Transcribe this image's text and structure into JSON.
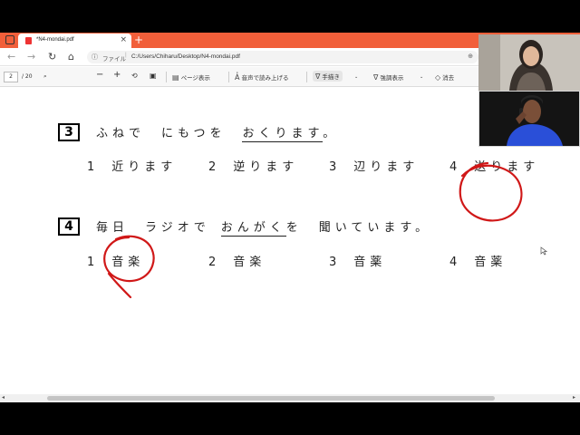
{
  "browser": {
    "tab_title": "*N4-mondai.pdf",
    "new_tab": "+",
    "close": "×",
    "address_prefix": "ファイル",
    "address_path": "C:/Users/Chiharu/Desktop/N4-mondai.pdf"
  },
  "pdf_toolbar": {
    "page": "2",
    "page_count": "/ 20",
    "zoom_out": "−",
    "zoom_in": "+",
    "page_view": "ページ表示",
    "read_aloud": "音声で読み上げる",
    "draw": "手描き",
    "highlight": "強調表示",
    "erase": "消去"
  },
  "questions": [
    {
      "number": "3",
      "pre": "ふねで　にもつを",
      "underlined": "おくります",
      "post": "。",
      "options": [
        {
          "n": "1",
          "text": "近ります"
        },
        {
          "n": "2",
          "text": "逆ります"
        },
        {
          "n": "3",
          "text": "辺ります"
        },
        {
          "n": "4",
          "text": "送ります"
        }
      ]
    },
    {
      "number": "4",
      "pre": "毎日　ラジオで",
      "underlined": "おんがく",
      "post": "を　聞いています。",
      "options": [
        {
          "n": "1",
          "text": "音楽"
        },
        {
          "n": "2",
          "text": "音楽"
        },
        {
          "n": "3",
          "text": "音薬"
        },
        {
          "n": "4",
          "text": "音薬"
        }
      ]
    }
  ],
  "annotations": {
    "ink_color": "#d01818"
  }
}
